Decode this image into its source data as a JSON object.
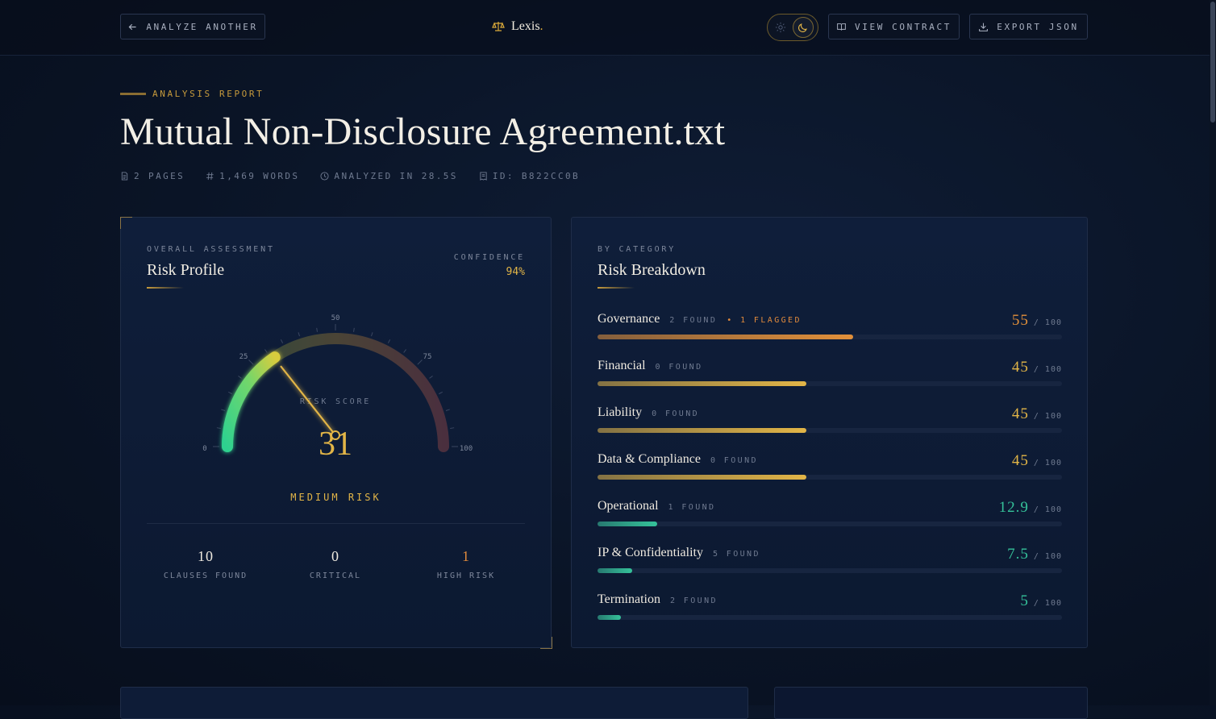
{
  "topbar": {
    "back_label": "ANALYZE ANOTHER",
    "brand": "Lexis",
    "brand_dot": ".",
    "view_label": "VIEW CONTRACT",
    "export_label": "EXPORT JSON"
  },
  "header": {
    "eyebrow": "ANALYSIS REPORT",
    "title": "Mutual Non-Disclosure Agreement.txt",
    "meta": {
      "pages": "2 PAGES",
      "words": "1,469 WORDS",
      "time": "ANALYZED IN 28.5S",
      "id": "ID: B822CC0B"
    }
  },
  "profile": {
    "eyebrow": "OVERALL ASSESSMENT",
    "title": "Risk Profile",
    "confidence_label": "CONFIDENCE",
    "confidence_value": "94%",
    "gauge": {
      "score": 31,
      "score_text": "31",
      "score_label": "RISK SCORE",
      "ticks": [
        "0",
        "25",
        "50",
        "75",
        "100"
      ]
    },
    "level": "MEDIUM RISK",
    "stats": [
      {
        "value": "10",
        "label": "CLAUSES FOUND",
        "color": "#efeae0"
      },
      {
        "value": "0",
        "label": "CRITICAL",
        "color": "#efeae0"
      },
      {
        "value": "1",
        "label": "HIGH RISK",
        "color": "#e08a3c"
      }
    ]
  },
  "breakdown": {
    "eyebrow": "BY CATEGORY",
    "title": "Risk Breakdown",
    "denominator": "/ 100",
    "rows": [
      {
        "name": "Governance",
        "found": "2 FOUND",
        "flag": "• 1 FLAGGED",
        "score": "55",
        "value": 55,
        "color": "#e2903a"
      },
      {
        "name": "Financial",
        "found": "0 FOUND",
        "flag": "",
        "score": "45",
        "value": 45,
        "color": "#e2b547"
      },
      {
        "name": "Liability",
        "found": "0 FOUND",
        "flag": "",
        "score": "45",
        "value": 45,
        "color": "#e2b547"
      },
      {
        "name": "Data & Compliance",
        "found": "0 FOUND",
        "flag": "",
        "score": "45",
        "value": 45,
        "color": "#e2b547"
      },
      {
        "name": "Operational",
        "found": "1 FOUND",
        "flag": "",
        "score": "12.9",
        "value": 12.9,
        "color": "#35c29a"
      },
      {
        "name": "IP & Confidentiality",
        "found": "5 FOUND",
        "flag": "",
        "score": "7.5",
        "value": 7.5,
        "color": "#35c29a"
      },
      {
        "name": "Termination",
        "found": "2 FOUND",
        "flag": "",
        "score": "5",
        "value": 5,
        "color": "#35c29a"
      }
    ]
  },
  "colors": {
    "accent_gold": "#e2b547",
    "accent_orange": "#e08a3c",
    "accent_green": "#35c29a",
    "background": "#0a1426"
  }
}
